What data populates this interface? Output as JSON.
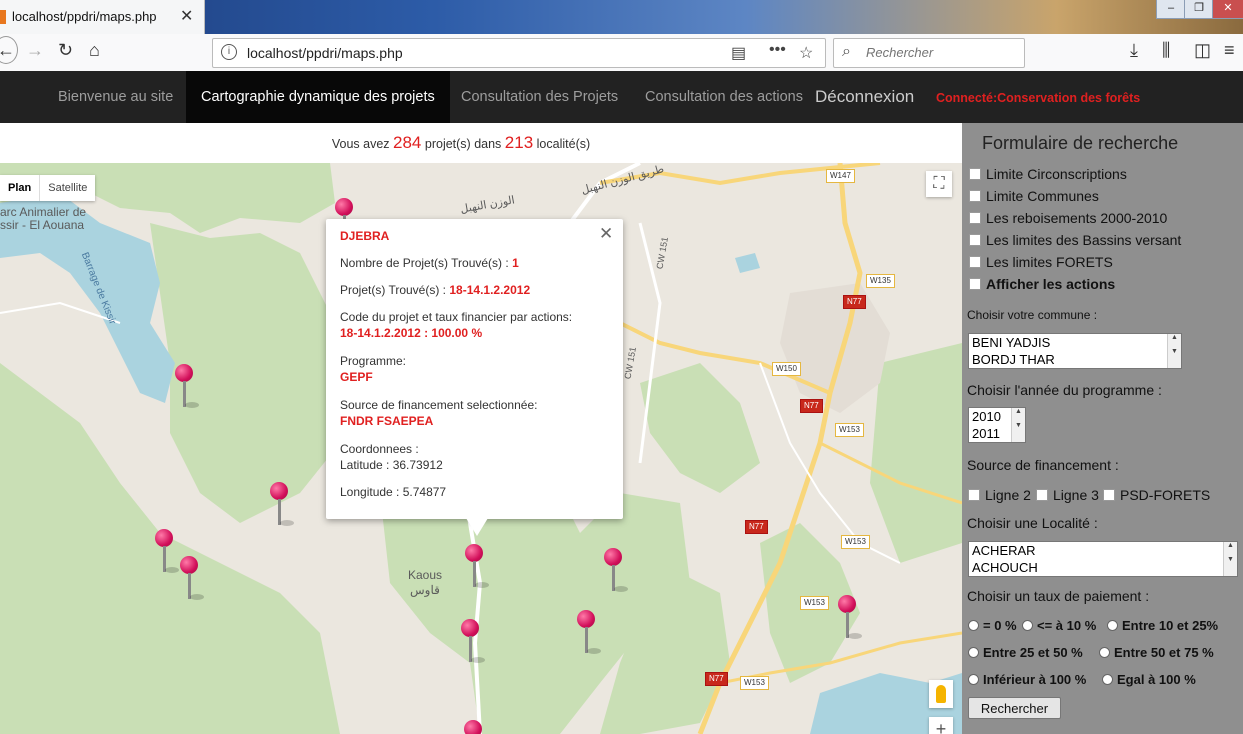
{
  "browser": {
    "tab_title": "localhost/ppdri/maps.php",
    "url": "localhost/ppdri/maps.php",
    "search_placeholder": "Rechercher"
  },
  "menu": {
    "items": [
      {
        "label": "Bienvenue au site"
      },
      {
        "label": "Cartographie dynamique des projets"
      },
      {
        "label": "Consultation des Projets"
      },
      {
        "label": "Consultation des actions"
      }
    ],
    "logout": "Déconnexion",
    "connected": "Connecté:Conservation des forêts"
  },
  "summary": {
    "prefix": "Vous avez",
    "projects_count": "284",
    "middle": "projet(s) dans",
    "localities_count": "213",
    "suffix": "localité(s)"
  },
  "map": {
    "type_plan": "Plan",
    "type_satellite": "Satellite",
    "labels": {
      "park": "arc Animalier de",
      "park2": "ssir - El Aouana",
      "dam": "Barrage de Kissir",
      "kaous": "Kaous",
      "kaous_ar": "قاوس",
      "road_ar1": "طريق الوزن النهبل",
      "road_ar2": "الوزن النهبل"
    },
    "roads": {
      "w147": "W147",
      "w135": "W135",
      "n77a": "N77",
      "w150": "W150",
      "n77b": "N77",
      "w153a": "W153",
      "n77c": "N77",
      "w153b": "W153",
      "w153c": "W153",
      "n77d": "N77",
      "w153d": "W153",
      "cw151a": "CW 151",
      "cw151b": "CW 151"
    }
  },
  "info": {
    "name": "DJEBRA",
    "nb_label": "Nombre de Projet(s) Trouvé(s) :",
    "nb_value": "1",
    "found_label": "Projet(s) Trouvé(s) :",
    "found_value": "18-14.1.2.2012",
    "code_label": "Code du projet et taux financier par actions:",
    "code_value": "18-14.1.2.2012 : 100.00 %",
    "programme_label": "Programme:",
    "programme_value": "GEPF",
    "source_label": "Source de financement selectionnée:",
    "source_value": "FNDR FSAEPEA",
    "coords_label": "Coordonnees :",
    "latitude": "Latitude : 36.73912",
    "longitude": "Longitude : 5.74877"
  },
  "form": {
    "title": "Formulaire de recherche",
    "checkboxes": [
      {
        "label": "Limite Circonscriptions"
      },
      {
        "label": "Limite Communes"
      },
      {
        "label": "Les reboisements 2000-2010"
      },
      {
        "label": "Les limites des Bassins versant"
      },
      {
        "label": "Les limites FORETS"
      },
      {
        "label": "Afficher les actions"
      }
    ],
    "commune_label": "Choisir votre commune :",
    "communes": [
      "BENI YADJIS",
      "BORDJ THAR"
    ],
    "year_label": "Choisir l'année du programme :",
    "years": [
      "2010",
      "2011"
    ],
    "source_label": "Source de financement :",
    "sources": [
      "Ligne 2",
      "Ligne 3",
      "PSD-FORETS"
    ],
    "locality_label": "Choisir une Localité :",
    "localities": [
      "ACHERAR",
      "ACHOUCH"
    ],
    "rate_label": "Choisir un taux de paiement :",
    "rates": [
      "= 0 %",
      "<= à 10 %",
      "Entre 10 et 25%",
      "Entre 25 et 50 %",
      "Entre 50 et 75 %",
      "Inférieur à 100 %",
      "Egal à 100 %"
    ],
    "search_button": "Rechercher"
  }
}
